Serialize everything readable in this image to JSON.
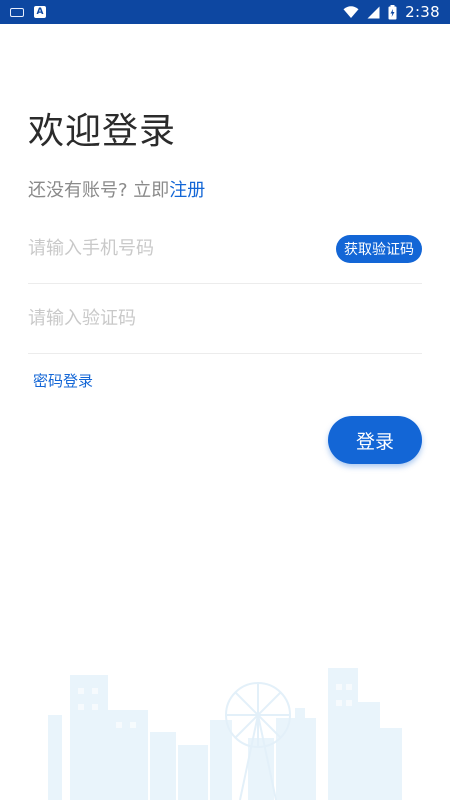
{
  "status_bar": {
    "time": "2:38",
    "left_icons": [
      "keyboard-icon",
      "app-a-icon"
    ],
    "right_icons": [
      "wifi-icon",
      "cell-signal-icon",
      "battery-charging-icon"
    ]
  },
  "login": {
    "title": "欢迎登录",
    "register_prompt": "还没有账号? 立即",
    "register_link": "注册",
    "phone_placeholder": "请输入手机号码",
    "get_code_label": "获取验证码",
    "code_placeholder": "请输入验证码",
    "password_login_label": "密码登录",
    "login_button_label": "登录"
  },
  "colors": {
    "status_bar": "#0d47a1",
    "accent": "#1366d6",
    "title_text": "#2b2b2b",
    "hint_text": "#c9c9c9",
    "skyline": "#e9f4fb"
  }
}
